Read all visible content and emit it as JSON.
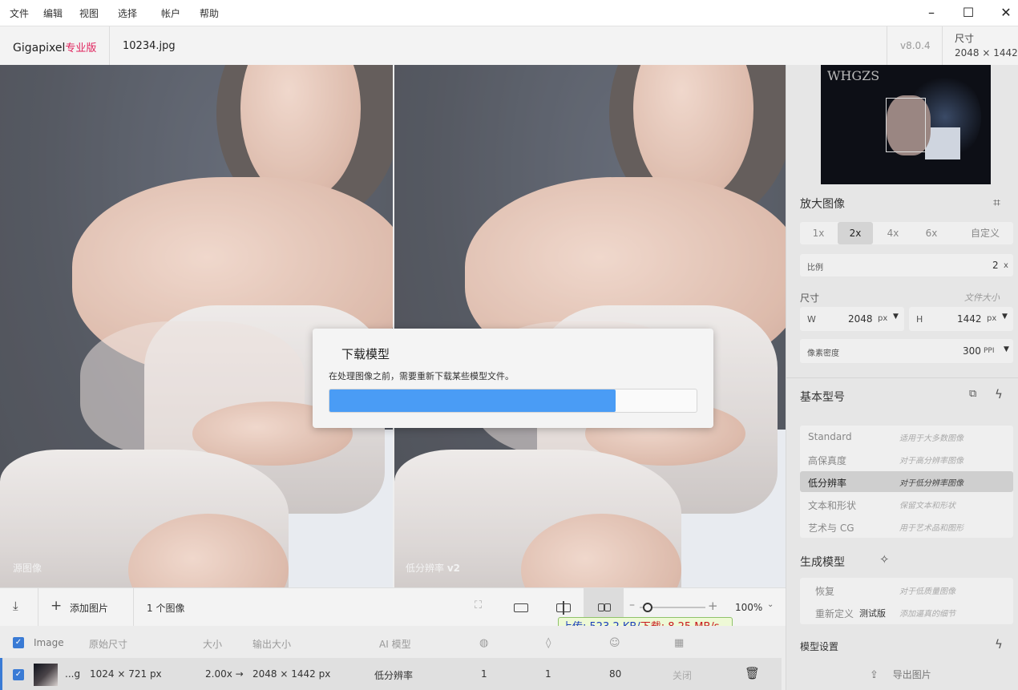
{
  "menu": [
    "文件",
    "编辑",
    "视图",
    "选择",
    "帐户",
    "帮助"
  ],
  "window_controls": [
    "minimize-icon",
    "maximize-icon",
    "close-icon"
  ],
  "app": {
    "name": "Gigapixel",
    "edition": "专业版",
    "file_name": "10234.jpg",
    "version": "v8.0.4",
    "size_label": "尺寸",
    "size_value": "2048 × 1442"
  },
  "preview": {
    "left_label": "源图像",
    "right_label": "低分辨率",
    "right_label_version": "v2"
  },
  "dialog": {
    "title": "下载模型",
    "message": "在处理图像之前，需要重新下载某些模型文件。",
    "progress": 0.78
  },
  "sidebar": {
    "enlarge_title": "放大图像",
    "scale_options": [
      "1x",
      "2x",
      "4x",
      "6x",
      "自定义"
    ],
    "scale_selected": "2x",
    "ratio_label": "比例",
    "ratio_value": "2",
    "ratio_unit": "x",
    "size_label": "尺寸",
    "file_size_label": "文件大小",
    "width_label": "W",
    "width_value": "2048",
    "width_unit": "px",
    "height_label": "H",
    "height_value": "1442",
    "height_unit": "px",
    "density_label": "像素密度",
    "density_value": "300",
    "density_unit": "PPI",
    "base_model_title": "基本型号",
    "base_models": [
      {
        "name": "Standard",
        "hint": "适用于大多数图像"
      },
      {
        "name": "高保真度",
        "hint": "对于高分辨率图像"
      },
      {
        "name": "低分辨率",
        "hint": "对于低分辨率图像",
        "selected": true
      },
      {
        "name": "文本和形状",
        "hint": "保留文本和形状"
      },
      {
        "name": "艺术与 CG",
        "hint": "用于艺术品和图形"
      }
    ],
    "gen_model_title": "生成模型",
    "gen_models": [
      {
        "name": "恢复",
        "hint": "对于低质量图像"
      },
      {
        "name": "重新定义",
        "badge": "测试版",
        "hint": "添加逼真的细节"
      }
    ],
    "model_settings_title": "模型设置",
    "export_label": "导出图片"
  },
  "toolbar": {
    "add_image_label": "添加图片",
    "image_count": "1 个图像",
    "zoom": "100%"
  },
  "net_speed": {
    "upload": "上传: 523.2 KB/",
    "download": "下载: 8.25 MB/s"
  },
  "table": {
    "headers": [
      "Image",
      "原始尺寸",
      "大小",
      "输出大小",
      "AI 模型"
    ],
    "row": {
      "name": "...g",
      "original_size": "1024 × 721 px",
      "scale": "2.00x →",
      "output_size": "2048 × 1442 px",
      "model": "低分辨率",
      "v1": "1",
      "v2": "1",
      "v3": "80",
      "state": "关闭"
    }
  },
  "colors": {
    "accent_blue": "#4a9cf5",
    "brand_red": "#e0245e",
    "selected_row": "#cfcfcf"
  }
}
